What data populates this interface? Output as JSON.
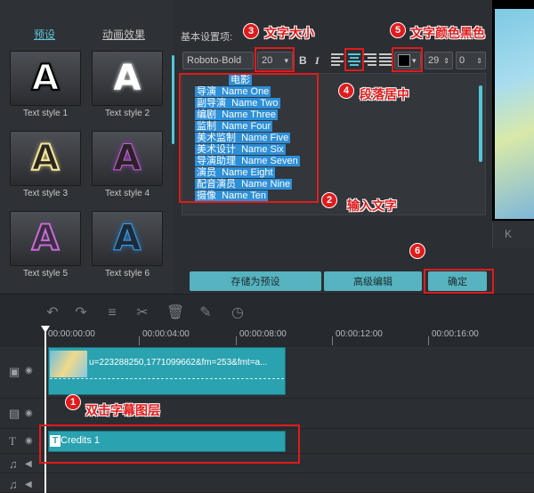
{
  "tabs": [
    {
      "label": "预设",
      "active": true
    },
    {
      "label": "动画效果",
      "active": false
    }
  ],
  "styles": [
    {
      "label": "Text style 1",
      "glyph": "A",
      "color": "#ffffff",
      "stroke": "#000000"
    },
    {
      "label": "Text style 2",
      "glyph": "A",
      "color": "#ffffff",
      "stroke": "#ffffff"
    },
    {
      "label": "Text style 3",
      "glyph": "A",
      "color": "#2a2620",
      "stroke": "#f5e6a0"
    },
    {
      "label": "Text style 4",
      "glyph": "A",
      "color": "#2a2226",
      "stroke": "#c060d0"
    },
    {
      "label": "Text style 5",
      "glyph": "A",
      "color": "#3a2e40",
      "stroke": "#c86ad8"
    },
    {
      "label": "Text style 6",
      "glyph": "A",
      "color": "#1e2a36",
      "stroke": "#3aa0e8"
    }
  ],
  "settings": {
    "title": "基本设置项:",
    "font": "Roboto-Bold",
    "size": "20",
    "bold": "B",
    "italic": "I",
    "text_color": "#000000",
    "spacing": "29",
    "kerning": "0"
  },
  "credits_text": [
    "电影",
    "导演  Name One",
    "副导演  Name Two",
    "编剧  Name Three",
    "监制  Name Four",
    "美术监制  Name Five",
    "美术设计  Name Six",
    "导演助理  Name Seven",
    "演员  Name Eight",
    "配音演员  Name Nine",
    "摄像  Name Ten"
  ],
  "buttons": {
    "save_preset": "存储为预设",
    "advanced": "高级编辑",
    "ok": "确定"
  },
  "preview": {
    "label": "K"
  },
  "timeline": {
    "ticks": [
      "00:00:00:00",
      "00:00:04:00",
      "00:00:08:00",
      "00:00:12:00",
      "00:00:16:00"
    ],
    "video_clip": "u=223288250,1771099662&fm=253&fmt=a...",
    "credits_clip": "Credits 1",
    "credits_icon": "T"
  },
  "annotations": {
    "a1": {
      "num": "1",
      "text": "双击字幕图层"
    },
    "a2": {
      "num": "2",
      "text": "输入文字"
    },
    "a3": {
      "num": "3",
      "text": "文字大小"
    },
    "a4": {
      "num": "4",
      "text": "段落居中"
    },
    "a5": {
      "num": "5",
      "text": "文字颜色黑色"
    },
    "a6": {
      "num": "6",
      "text": ""
    }
  },
  "colors": {
    "accent": "#52c6d9",
    "annotation": "#e01b1b",
    "clip": "#2aa2b0",
    "selection": "#2d8fd8"
  }
}
